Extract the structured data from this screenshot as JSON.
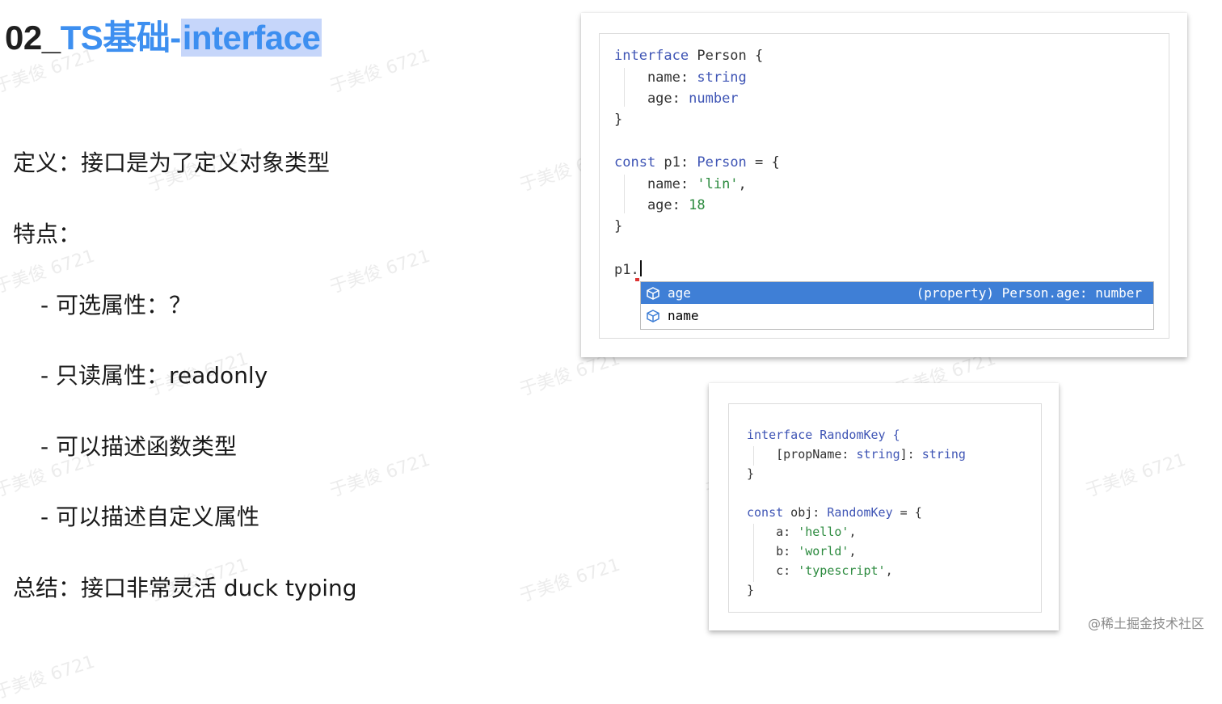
{
  "title": {
    "number": "02_",
    "topic": "TS基础-",
    "highlight": "interface"
  },
  "bullets": {
    "definition": "定义：接口是为了定义对象类型",
    "features_label": "特点：",
    "optional": "- 可选属性：？",
    "readonly": "- 只读属性：readonly",
    "function_types": "- 可以描述函数类型",
    "custom_props": "- 可以描述自定义属性",
    "summary": "总结：接口非常灵活 duck typing"
  },
  "code1": {
    "l1": {
      "kw": "interface",
      "rest": " Person {"
    },
    "l2": {
      "pre": "    name: ",
      "type": "string"
    },
    "l3": {
      "pre": "    age: ",
      "type": "number"
    },
    "l4": "}",
    "l5": {
      "kw": "const",
      "pre": " p1: ",
      "type": "Person",
      "rest": " = {"
    },
    "l6": {
      "pre": "    name: ",
      "str": "'lin'",
      "rest": ","
    },
    "l7": {
      "pre": "    age: ",
      "num": "18"
    },
    "l8": "}",
    "l9": "p1.",
    "autocomplete": [
      {
        "label": "age",
        "detail": "(property) Person.age: number",
        "selected": true
      },
      {
        "label": "name",
        "detail": "",
        "selected": false
      }
    ]
  },
  "code2": {
    "l1": {
      "kw": "interface",
      "rest": " RandomKey {"
    },
    "l2": {
      "pre": "    [propName: ",
      "t1": "string",
      "mid": "]: ",
      "t2": "string"
    },
    "l3": "}",
    "l4": {
      "kw": "const",
      "pre": " obj: ",
      "type": "RandomKey",
      "rest": " = {"
    },
    "l5": {
      "pre": "    a: ",
      "str": "'hello'",
      "rest": ","
    },
    "l6": {
      "pre": "    b: ",
      "str": "'world'",
      "rest": ","
    },
    "l7": {
      "pre": "    c: ",
      "str": "'typescript'",
      "rest": ","
    },
    "l8": "}"
  },
  "watermark_text": "于美俊 6721",
  "footer": "@稀土掘金技术社区",
  "colors": {
    "title_blue": "#3d8ff0",
    "highlight_bg": "#c6d6fa",
    "keyword": "#3f55b5",
    "string": "#2b8a3e",
    "selection": "#3f7fd6"
  }
}
